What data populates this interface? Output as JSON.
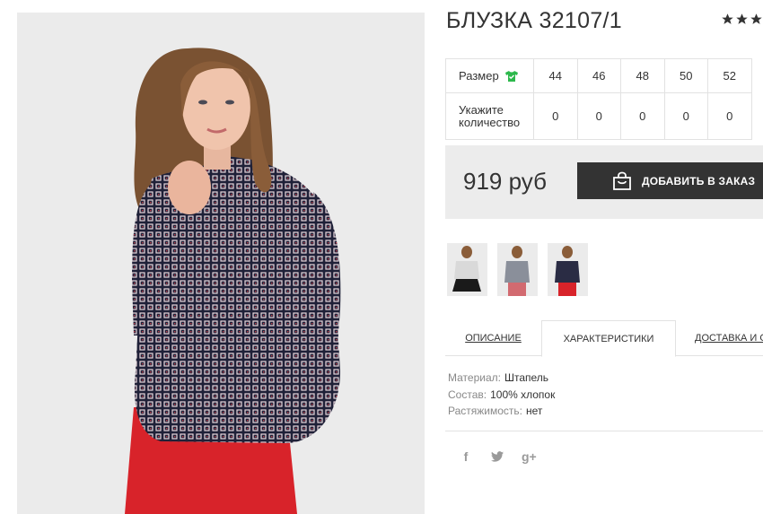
{
  "product": {
    "title": "БЛУЗКА 32107/1",
    "rating_icon": "star-icon",
    "rating_stars": 3
  },
  "sizes": {
    "size_label": "Размер",
    "size_icon": "tshirt-icon",
    "qty_label_line1": "Укажите",
    "qty_label_line2": "количество",
    "values": [
      "44",
      "46",
      "48",
      "50",
      "52"
    ],
    "quantities": [
      "0",
      "0",
      "0",
      "0",
      "0"
    ]
  },
  "purchase": {
    "price": "919 руб",
    "button_label": "ДОБАВИТЬ В ЗАКАЗ",
    "button_icon": "shopping-bag-icon",
    "button_color": "#333333"
  },
  "tabs": {
    "description": "ОПИСАНИЕ",
    "characteristics": "ХАРАКТЕРИСТИКИ",
    "delivery": "ДОСТАВКА И О"
  },
  "characteristics": [
    {
      "key": "Материал:",
      "value": "Штапель"
    },
    {
      "key": "Состав:",
      "value": "100% хлопок"
    },
    {
      "key": "Растяжимость:",
      "value": "нет"
    }
  ],
  "social": {
    "facebook": "f",
    "twitter_icon": "twitter-icon",
    "gplus": "g+"
  },
  "colors": {
    "accent_dark": "#333333",
    "panel_bg": "#ececec",
    "size_icon_green": "#2db84c"
  }
}
